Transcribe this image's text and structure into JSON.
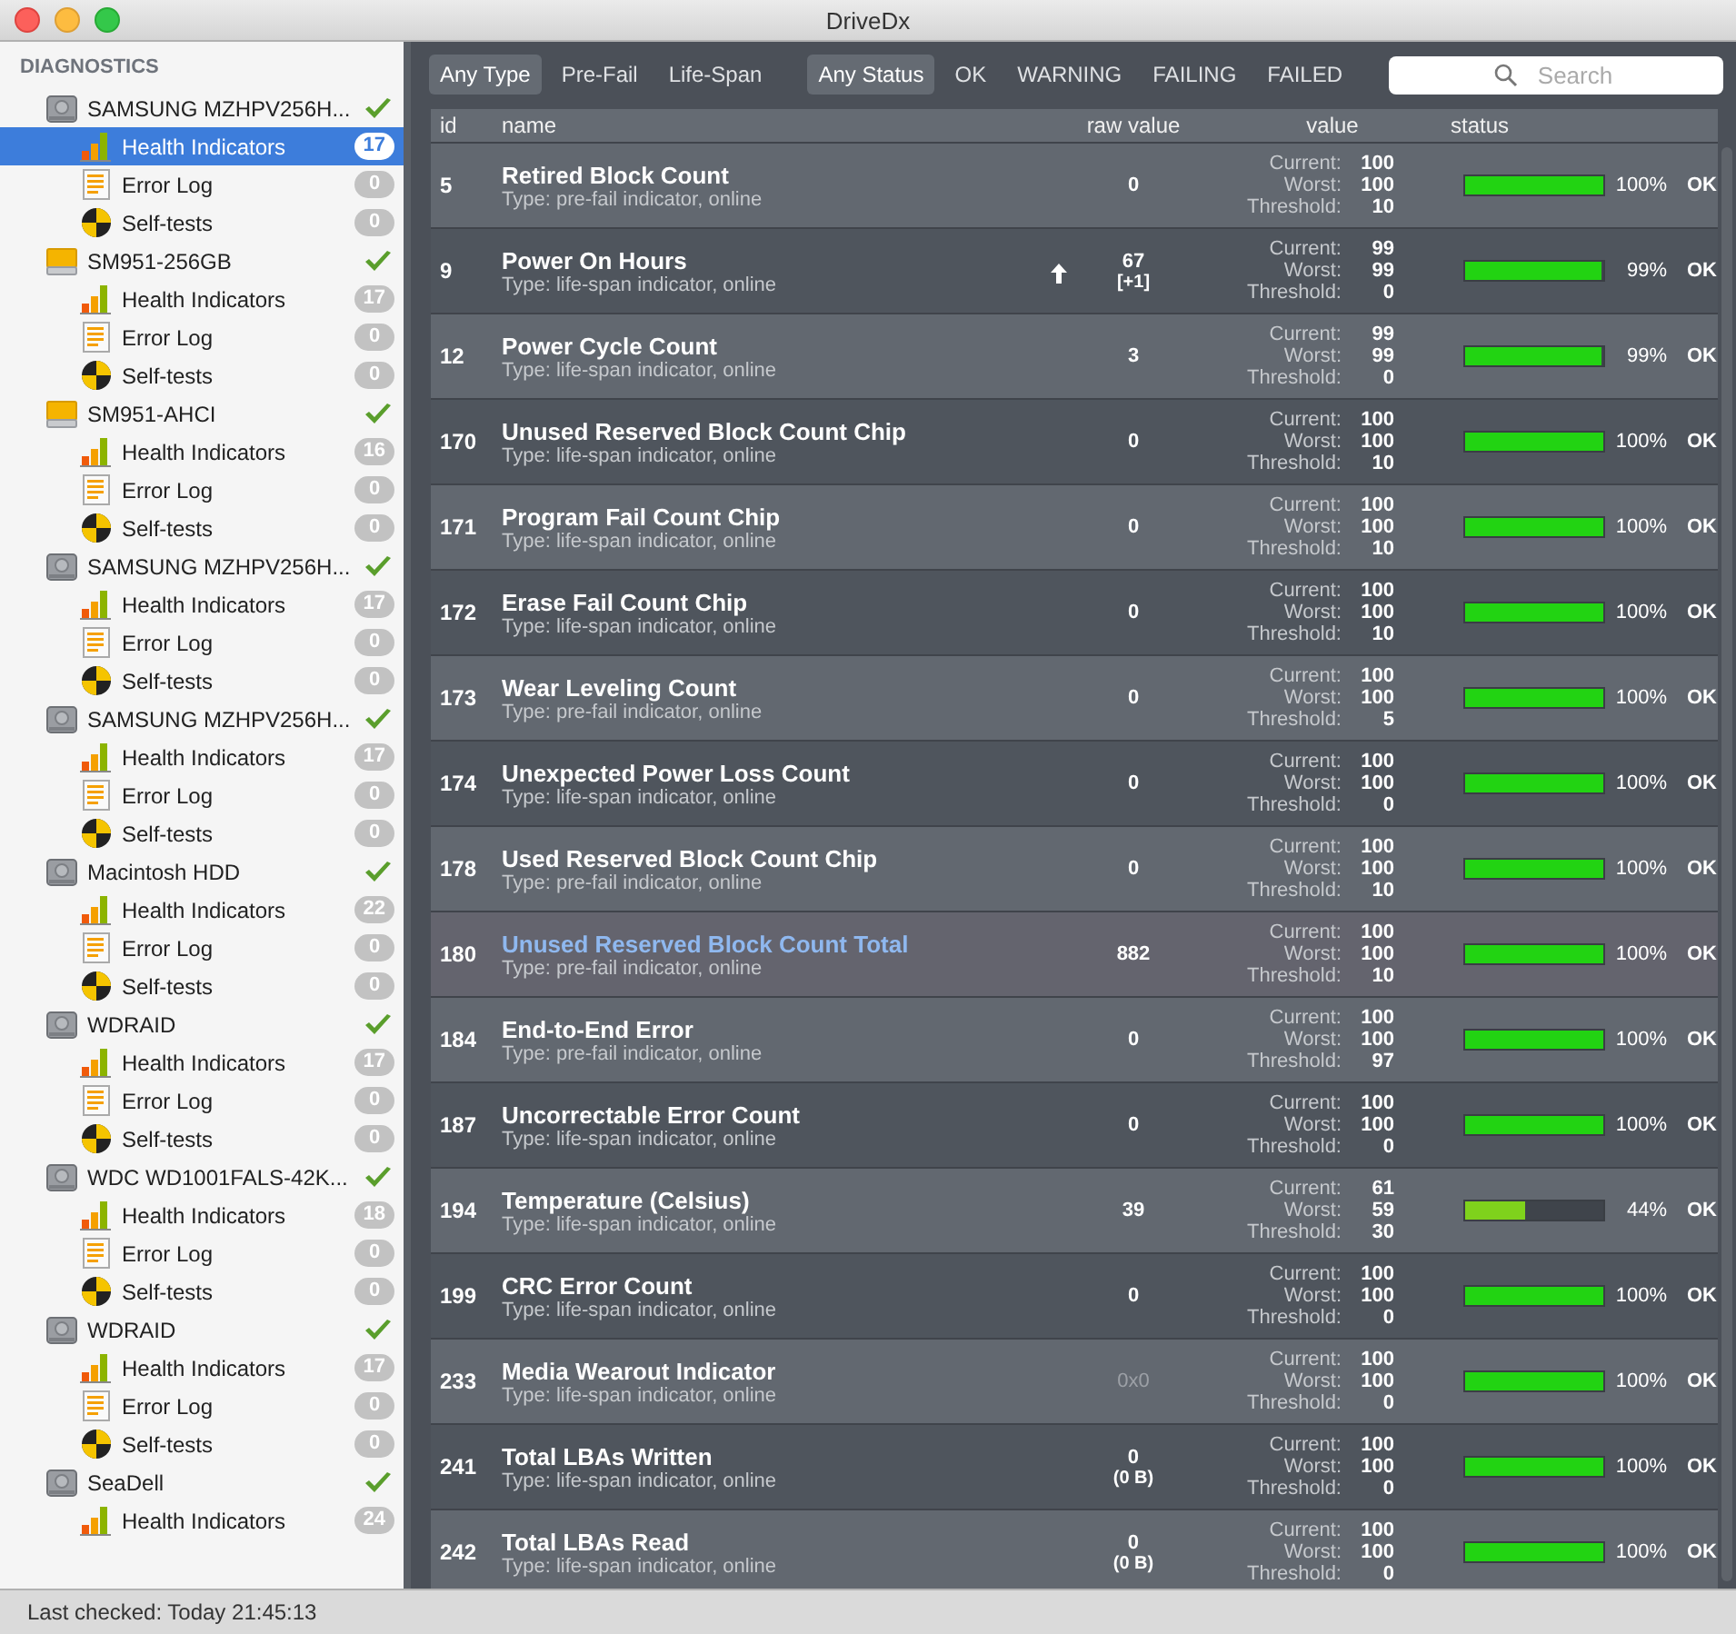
{
  "window": {
    "title": "DriveDx"
  },
  "sidebar": {
    "heading": "DIAGNOSTICS",
    "drives": [
      {
        "name": "SAMSUNG MZHPV256H...",
        "kind": "hdd",
        "healthy": true,
        "items": [
          {
            "kind": "health",
            "label": "Health Indicators",
            "count": "17",
            "selected": true
          },
          {
            "kind": "log",
            "label": "Error Log",
            "count": "0",
            "selected": false
          },
          {
            "kind": "test",
            "label": "Self-tests",
            "count": "0",
            "selected": false
          }
        ]
      },
      {
        "name": "SM951-256GB",
        "kind": "ssd",
        "healthy": true,
        "items": [
          {
            "kind": "health",
            "label": "Health Indicators",
            "count": "17",
            "selected": false
          },
          {
            "kind": "log",
            "label": "Error Log",
            "count": "0",
            "selected": false
          },
          {
            "kind": "test",
            "label": "Self-tests",
            "count": "0",
            "selected": false
          }
        ]
      },
      {
        "name": "SM951-AHCI",
        "kind": "ssd",
        "healthy": true,
        "items": [
          {
            "kind": "health",
            "label": "Health Indicators",
            "count": "16",
            "selected": false
          },
          {
            "kind": "log",
            "label": "Error Log",
            "count": "0",
            "selected": false
          },
          {
            "kind": "test",
            "label": "Self-tests",
            "count": "0",
            "selected": false
          }
        ]
      },
      {
        "name": "SAMSUNG MZHPV256H...",
        "kind": "hdd",
        "healthy": true,
        "items": [
          {
            "kind": "health",
            "label": "Health Indicators",
            "count": "17",
            "selected": false
          },
          {
            "kind": "log",
            "label": "Error Log",
            "count": "0",
            "selected": false
          },
          {
            "kind": "test",
            "label": "Self-tests",
            "count": "0",
            "selected": false
          }
        ]
      },
      {
        "name": "SAMSUNG MZHPV256H...",
        "kind": "hdd",
        "healthy": true,
        "items": [
          {
            "kind": "health",
            "label": "Health Indicators",
            "count": "17",
            "selected": false
          },
          {
            "kind": "log",
            "label": "Error Log",
            "count": "0",
            "selected": false
          },
          {
            "kind": "test",
            "label": "Self-tests",
            "count": "0",
            "selected": false
          }
        ]
      },
      {
        "name": "Macintosh HDD",
        "kind": "hdd",
        "healthy": true,
        "items": [
          {
            "kind": "health",
            "label": "Health Indicators",
            "count": "22",
            "selected": false
          },
          {
            "kind": "log",
            "label": "Error Log",
            "count": "0",
            "selected": false
          },
          {
            "kind": "test",
            "label": "Self-tests",
            "count": "0",
            "selected": false
          }
        ]
      },
      {
        "name": "WDRAID",
        "kind": "hdd",
        "healthy": true,
        "items": [
          {
            "kind": "health",
            "label": "Health Indicators",
            "count": "17",
            "selected": false
          },
          {
            "kind": "log",
            "label": "Error Log",
            "count": "0",
            "selected": false
          },
          {
            "kind": "test",
            "label": "Self-tests",
            "count": "0",
            "selected": false
          }
        ]
      },
      {
        "name": "WDC WD1001FALS-42K...",
        "kind": "hdd",
        "healthy": true,
        "items": [
          {
            "kind": "health",
            "label": "Health Indicators",
            "count": "18",
            "selected": false
          },
          {
            "kind": "log",
            "label": "Error Log",
            "count": "0",
            "selected": false
          },
          {
            "kind": "test",
            "label": "Self-tests",
            "count": "0",
            "selected": false
          }
        ]
      },
      {
        "name": "WDRAID",
        "kind": "hdd",
        "healthy": true,
        "items": [
          {
            "kind": "health",
            "label": "Health Indicators",
            "count": "17",
            "selected": false
          },
          {
            "kind": "log",
            "label": "Error Log",
            "count": "0",
            "selected": false
          },
          {
            "kind": "test",
            "label": "Self-tests",
            "count": "0",
            "selected": false
          }
        ]
      },
      {
        "name": "SeaDell",
        "kind": "hdd",
        "healthy": true,
        "items": [
          {
            "kind": "health",
            "label": "Health Indicators",
            "count": "24",
            "selected": false
          }
        ]
      }
    ]
  },
  "filters": {
    "type": [
      {
        "label": "Any Type",
        "selected": true
      },
      {
        "label": "Pre-Fail",
        "selected": false
      },
      {
        "label": "Life-Span",
        "selected": false
      }
    ],
    "status": [
      {
        "label": "Any Status",
        "selected": true
      },
      {
        "label": "OK",
        "selected": false
      },
      {
        "label": "WARNING",
        "selected": false
      },
      {
        "label": "FAILING",
        "selected": false
      },
      {
        "label": "FAILED",
        "selected": false
      }
    ]
  },
  "search": {
    "placeholder": "Search"
  },
  "table": {
    "columns": [
      "id",
      "name",
      "raw value",
      "value",
      "status"
    ],
    "rows": [
      {
        "id": "5",
        "name": "Retired Block Count",
        "type": "Type: pre-fail indicator, online",
        "raw": "0",
        "values": [
          {
            "label": "Current:",
            "value": "100"
          },
          {
            "label": "Worst:",
            "value": "100"
          },
          {
            "label": "Threshold:",
            "value": "10"
          }
        ],
        "level": 1,
        "percent": "100%",
        "status": "OK",
        "selected": false
      },
      {
        "id": "9",
        "name": "Power On Hours",
        "type": "Type: life-span indicator, online",
        "raw": "67",
        "raw_change": "[+1]",
        "rising": true,
        "values": [
          {
            "label": "Current:",
            "value": "99"
          },
          {
            "label": "Worst:",
            "value": "99"
          },
          {
            "label": "Threshold:",
            "value": "0"
          }
        ],
        "level": 0.99,
        "percent": "99%",
        "status": "OK",
        "selected": false
      },
      {
        "id": "12",
        "name": "Power Cycle Count",
        "type": "Type: life-span indicator, online",
        "raw": "3",
        "values": [
          {
            "label": "Current:",
            "value": "99"
          },
          {
            "label": "Worst:",
            "value": "99"
          },
          {
            "label": "Threshold:",
            "value": "0"
          }
        ],
        "level": 0.99,
        "percent": "99%",
        "status": "OK",
        "selected": false
      },
      {
        "id": "170",
        "name": "Unused Reserved Block Count Chip",
        "type": "Type: life-span indicator, online",
        "raw": "0",
        "values": [
          {
            "label": "Current:",
            "value": "100"
          },
          {
            "label": "Worst:",
            "value": "100"
          },
          {
            "label": "Threshold:",
            "value": "10"
          }
        ],
        "level": 1,
        "percent": "100%",
        "status": "OK",
        "selected": false
      },
      {
        "id": "171",
        "name": "Program Fail Count Chip",
        "type": "Type: life-span indicator, online",
        "raw": "0",
        "values": [
          {
            "label": "Current:",
            "value": "100"
          },
          {
            "label": "Worst:",
            "value": "100"
          },
          {
            "label": "Threshold:",
            "value": "10"
          }
        ],
        "level": 1,
        "percent": "100%",
        "status": "OK",
        "selected": false
      },
      {
        "id": "172",
        "name": "Erase Fail Count Chip",
        "type": "Type: life-span indicator, online",
        "raw": "0",
        "values": [
          {
            "label": "Current:",
            "value": "100"
          },
          {
            "label": "Worst:",
            "value": "100"
          },
          {
            "label": "Threshold:",
            "value": "10"
          }
        ],
        "level": 1,
        "percent": "100%",
        "status": "OK",
        "selected": false
      },
      {
        "id": "173",
        "name": "Wear Leveling Count",
        "type": "Type: pre-fail indicator, online",
        "raw": "0",
        "values": [
          {
            "label": "Current:",
            "value": "100"
          },
          {
            "label": "Worst:",
            "value": "100"
          },
          {
            "label": "Threshold:",
            "value": "5"
          }
        ],
        "level": 1,
        "percent": "100%",
        "status": "OK",
        "selected": false
      },
      {
        "id": "174",
        "name": "Unexpected Power Loss Count",
        "type": "Type: life-span indicator, online",
        "raw": "0",
        "values": [
          {
            "label": "Current:",
            "value": "100"
          },
          {
            "label": "Worst:",
            "value": "100"
          },
          {
            "label": "Threshold:",
            "value": "0"
          }
        ],
        "level": 1,
        "percent": "100%",
        "status": "OK",
        "selected": false
      },
      {
        "id": "178",
        "name": "Used Reserved Block Count Chip",
        "type": "Type: pre-fail indicator, online",
        "raw": "0",
        "values": [
          {
            "label": "Current:",
            "value": "100"
          },
          {
            "label": "Worst:",
            "value": "100"
          },
          {
            "label": "Threshold:",
            "value": "10"
          }
        ],
        "level": 1,
        "percent": "100%",
        "status": "OK",
        "selected": false
      },
      {
        "id": "180",
        "name": "Unused Reserved Block Count Total",
        "type": "Type: pre-fail indicator, online",
        "raw": "882",
        "values": [
          {
            "label": "Current:",
            "value": "100"
          },
          {
            "label": "Worst:",
            "value": "100"
          },
          {
            "label": "Threshold:",
            "value": "10"
          }
        ],
        "level": 1,
        "percent": "100%",
        "status": "OK",
        "selected": true
      },
      {
        "id": "184",
        "name": "End-to-End Error",
        "type": "Type: pre-fail indicator, online",
        "raw": "0",
        "values": [
          {
            "label": "Current:",
            "value": "100"
          },
          {
            "label": "Worst:",
            "value": "100"
          },
          {
            "label": "Threshold:",
            "value": "97"
          }
        ],
        "level": 1,
        "percent": "100%",
        "status": "OK",
        "selected": false
      },
      {
        "id": "187",
        "name": "Uncorrectable Error Count",
        "type": "Type: life-span indicator, online",
        "raw": "0",
        "values": [
          {
            "label": "Current:",
            "value": "100"
          },
          {
            "label": "Worst:",
            "value": "100"
          },
          {
            "label": "Threshold:",
            "value": "0"
          }
        ],
        "level": 1,
        "percent": "100%",
        "status": "OK",
        "selected": false
      },
      {
        "id": "194",
        "name": "Temperature (Celsius)",
        "type": "Type: life-span indicator, online",
        "raw": "39",
        "values": [
          {
            "label": "Current:",
            "value": "61"
          },
          {
            "label": "Worst:",
            "value": "59"
          },
          {
            "label": "Threshold:",
            "value": "30"
          }
        ],
        "level": 0.44,
        "percent": "44%",
        "status": "OK",
        "selected": false
      },
      {
        "id": "199",
        "name": "CRC Error Count",
        "type": "Type: life-span indicator, online",
        "raw": "0",
        "values": [
          {
            "label": "Current:",
            "value": "100"
          },
          {
            "label": "Worst:",
            "value": "100"
          },
          {
            "label": "Threshold:",
            "value": "0"
          }
        ],
        "level": 1,
        "percent": "100%",
        "status": "OK",
        "selected": false
      },
      {
        "id": "233",
        "name": "Media Wearout Indicator",
        "type": "Type: life-span indicator, online",
        "raw": "0x0",
        "raw_muted": true,
        "values": [
          {
            "label": "Current:",
            "value": "100"
          },
          {
            "label": "Worst:",
            "value": "100"
          },
          {
            "label": "Threshold:",
            "value": "0"
          }
        ],
        "level": 1,
        "percent": "100%",
        "status": "OK",
        "selected": false
      },
      {
        "id": "241",
        "name": "Total LBAs Written",
        "type": "Type: life-span indicator, online",
        "raw": "0",
        "raw_change": "(0 B)",
        "values": [
          {
            "label": "Current:",
            "value": "100"
          },
          {
            "label": "Worst:",
            "value": "100"
          },
          {
            "label": "Threshold:",
            "value": "0"
          }
        ],
        "level": 1,
        "percent": "100%",
        "status": "OK",
        "selected": false
      },
      {
        "id": "242",
        "name": "Total LBAs Read",
        "type": "Type: life-span indicator, online",
        "raw": "0",
        "raw_change": "(0 B)",
        "values": [
          {
            "label": "Current:",
            "value": "100"
          },
          {
            "label": "Worst:",
            "value": "100"
          },
          {
            "label": "Threshold:",
            "value": "0"
          }
        ],
        "level": 1,
        "percent": "100%",
        "status": "OK",
        "selected": false
      }
    ]
  },
  "status_bar": {
    "text": "Last checked: Today 21:45:13"
  }
}
